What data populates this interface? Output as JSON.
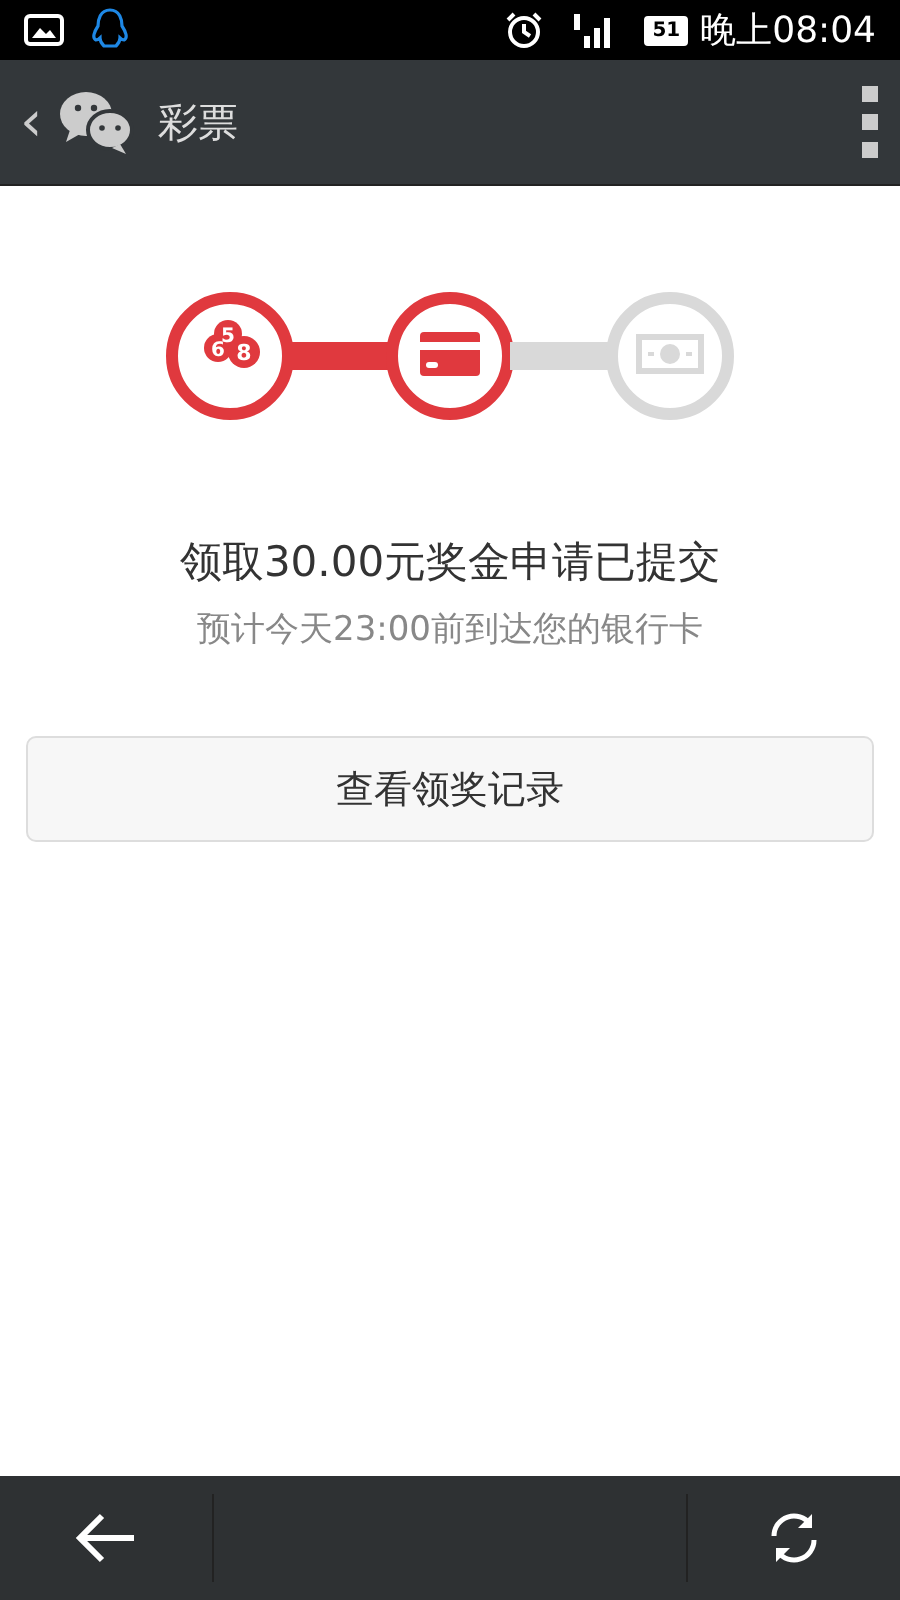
{
  "status_bar": {
    "battery": "51",
    "time": "晚上08:04"
  },
  "toolbar": {
    "back": "‹",
    "title": "彩票"
  },
  "steps": [
    {
      "kind": "balls",
      "done": true,
      "digits": [
        "5",
        "6",
        "8"
      ]
    },
    {
      "kind": "card",
      "done": true
    },
    {
      "kind": "cash",
      "done": false
    }
  ],
  "message": {
    "title": "领取30.00元奖金申请已提交",
    "subtitle": "预计今天23:00前到达您的银行卡"
  },
  "button": "查看领奖记录"
}
